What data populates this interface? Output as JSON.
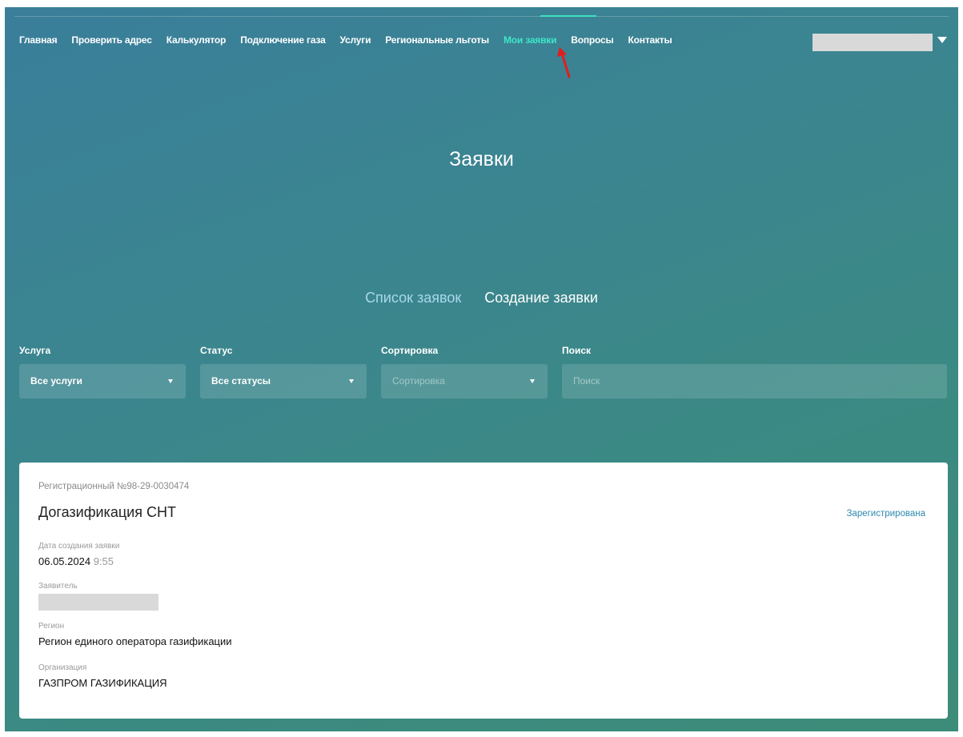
{
  "nav": {
    "items": [
      {
        "label": "Главная"
      },
      {
        "label": "Проверить адрес"
      },
      {
        "label": "Калькулятор"
      },
      {
        "label": "Подключение газа"
      },
      {
        "label": "Услуги"
      },
      {
        "label": "Региональные льготы"
      },
      {
        "label": "Мои заявки",
        "active": true
      },
      {
        "label": "Вопросы"
      },
      {
        "label": "Контакты"
      }
    ],
    "active_color": "#40e6c8"
  },
  "page": {
    "title": "Заявки"
  },
  "tabs": {
    "list": "Список заявок",
    "create": "Создание заявки"
  },
  "filters": {
    "service": {
      "label": "Услуга",
      "value": "Все услуги"
    },
    "status": {
      "label": "Статус",
      "value": "Все статусы"
    },
    "sort": {
      "label": "Сортировка",
      "placeholder": "Сортировка"
    },
    "search": {
      "label": "Поиск",
      "placeholder": "Поиск"
    }
  },
  "application": {
    "reg_number": "Регистрационный №98-29-0030474",
    "service_name": "Догазификация СНТ",
    "status": "Зарегистрирована",
    "created_label": "Дата создания заявки",
    "created_date": "06.05.2024",
    "created_time": "9:55",
    "applicant_label": "Заявитель",
    "region_label": "Регион",
    "region_value": "Регион единого оператора газификации",
    "org_label": "Организация",
    "org_value": "ГАЗПРОМ ГАЗИФИКАЦИЯ"
  },
  "colors": {
    "background_start": "#3a7e9a",
    "background_end": "#3d8c79",
    "status_link": "#2e8ab0",
    "annotation_arrow": "#e01e1e"
  }
}
